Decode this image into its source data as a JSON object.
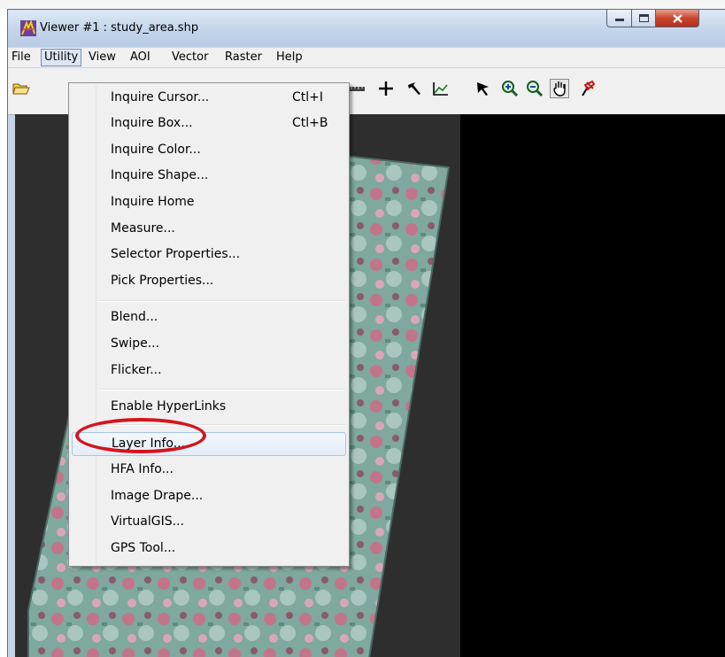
{
  "window": {
    "title": "Viewer #1 : study_area.shp",
    "controls": {
      "minimize_icon": "minimize-icon",
      "maximize_icon": "maximize-icon",
      "close_icon": "close-icon"
    }
  },
  "menubar": {
    "items": [
      "File",
      "Utility",
      "View",
      "AOI",
      "Vector",
      "Raster",
      "Help"
    ],
    "active": "Utility"
  },
  "toolbar": {
    "icons": [
      "open-folder-icon",
      "ruler-icon",
      "crosshair-icon",
      "arrow-tool-icon",
      "profile-icon",
      "select-pointer-icon",
      "zoom-in-icon",
      "zoom-out-icon",
      "pan-hand-icon",
      "pin-icon"
    ]
  },
  "dropdown": {
    "groups": [
      [
        {
          "label": "Inquire Cursor...",
          "shortcut": "Ctl+I"
        },
        {
          "label": "Inquire Box...",
          "shortcut": "Ctl+B"
        },
        {
          "label": "Inquire Color...",
          "shortcut": ""
        },
        {
          "label": "Inquire Shape...",
          "shortcut": ""
        },
        {
          "label": "Inquire Home",
          "shortcut": ""
        },
        {
          "label": "Measure...",
          "shortcut": ""
        },
        {
          "label": "Selector Properties...",
          "shortcut": ""
        },
        {
          "label": "Pick Properties...",
          "shortcut": ""
        }
      ],
      [
        {
          "label": "Blend...",
          "shortcut": ""
        },
        {
          "label": "Swipe...",
          "shortcut": ""
        },
        {
          "label": "Flicker...",
          "shortcut": ""
        }
      ],
      [
        {
          "label": "Enable HyperLinks",
          "shortcut": ""
        }
      ],
      [
        {
          "label": "Layer Info...",
          "shortcut": "",
          "highlighted": true
        },
        {
          "label": "HFA Info...",
          "shortcut": ""
        },
        {
          "label": "Image Drape...",
          "shortcut": ""
        },
        {
          "label": "VirtualGIS...",
          "shortcut": ""
        },
        {
          "label": "GPS Tool...",
          "shortcut": ""
        }
      ]
    ]
  },
  "annotation": {
    "color": "#d4141c",
    "target": "Layer Info..."
  }
}
